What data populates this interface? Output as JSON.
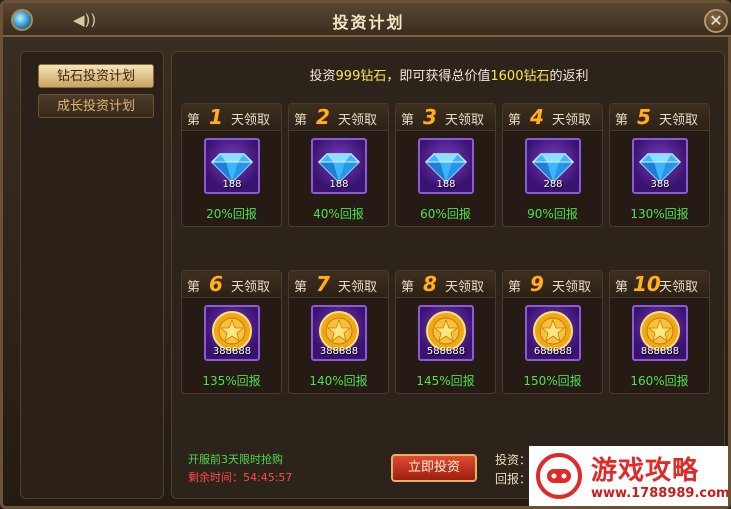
{
  "window": {
    "title": "投资计划"
  },
  "tabs": [
    {
      "label": "钻石投资计划",
      "active": true
    },
    {
      "label": "成长投资计划",
      "active": false
    }
  ],
  "headline": {
    "pre": "投资",
    "amount": "999钻石",
    "mid": "，即可获得总价值",
    "total": "1600钻石",
    "post": "的返利"
  },
  "days": [
    {
      "pre": "第",
      "num": "1",
      "post": "天领取",
      "reward": "diamond",
      "amount": "188",
      "return": "20%回报"
    },
    {
      "pre": "第",
      "num": "2",
      "post": "天领取",
      "reward": "diamond",
      "amount": "188",
      "return": "40%回报"
    },
    {
      "pre": "第",
      "num": "3",
      "post": "天领取",
      "reward": "diamond",
      "amount": "188",
      "return": "60%回报"
    },
    {
      "pre": "第",
      "num": "4",
      "post": "天领取",
      "reward": "diamond",
      "amount": "288",
      "return": "90%回报"
    },
    {
      "pre": "第",
      "num": "5",
      "post": "天领取",
      "reward": "diamond",
      "amount": "388",
      "return": "130%回报"
    },
    {
      "pre": "第",
      "num": "6",
      "post": "天领取",
      "reward": "coin",
      "amount": "388888",
      "return": "135%回报"
    },
    {
      "pre": "第",
      "num": "7",
      "post": "天领取",
      "reward": "coin",
      "amount": "388888",
      "return": "140%回报"
    },
    {
      "pre": "第",
      "num": "8",
      "post": "天领取",
      "reward": "coin",
      "amount": "588888",
      "return": "145%回报"
    },
    {
      "pre": "第",
      "num": "9",
      "post": "天领取",
      "reward": "coin",
      "amount": "688888",
      "return": "150%回报"
    },
    {
      "pre": "第",
      "num": "10",
      "post": "天领取",
      "reward": "coin",
      "amount": "888888",
      "return": "160%回报"
    }
  ],
  "footer": {
    "promo": "开服前3天限时抢购",
    "timer": "剩余时间：54:45:57",
    "button": "立即投资",
    "invest_label": "投资：",
    "return_label": "回报："
  },
  "watermark": {
    "text": "游戏攻略",
    "url": "www.1788989.com"
  },
  "colors": {
    "accent_gold": "#ffb020",
    "return_green": "#4fe04f",
    "timer_red": "#ff4a4a"
  },
  "icons": [
    "orb-icon",
    "sound-icon",
    "close-icon",
    "diamond-icon",
    "gold-coin-icon"
  ]
}
